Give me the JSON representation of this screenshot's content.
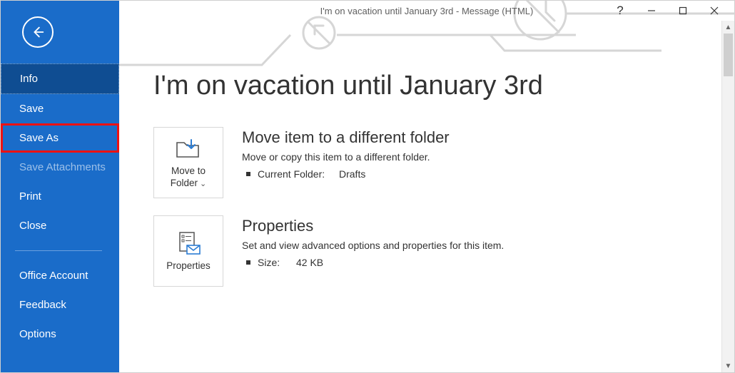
{
  "window": {
    "title": "I'm on vacation until January 3rd  -  Message (HTML)"
  },
  "sidebar": {
    "items": [
      {
        "label": "Info"
      },
      {
        "label": "Save"
      },
      {
        "label": "Save As"
      },
      {
        "label": "Save Attachments"
      },
      {
        "label": "Print"
      },
      {
        "label": "Close"
      },
      {
        "label": "Office Account"
      },
      {
        "label": "Feedback"
      },
      {
        "label": "Options"
      }
    ]
  },
  "page": {
    "title": "I'm on vacation until January 3rd"
  },
  "move": {
    "button_line1": "Move to",
    "button_line2": "Folder",
    "title": "Move item to a different folder",
    "desc": "Move or copy this item to a different folder.",
    "key": "Current Folder:",
    "value": "Drafts"
  },
  "props": {
    "button": "Properties",
    "title": "Properties",
    "desc": "Set and view advanced options and properties for this item.",
    "key": "Size:",
    "value": "42 KB"
  }
}
